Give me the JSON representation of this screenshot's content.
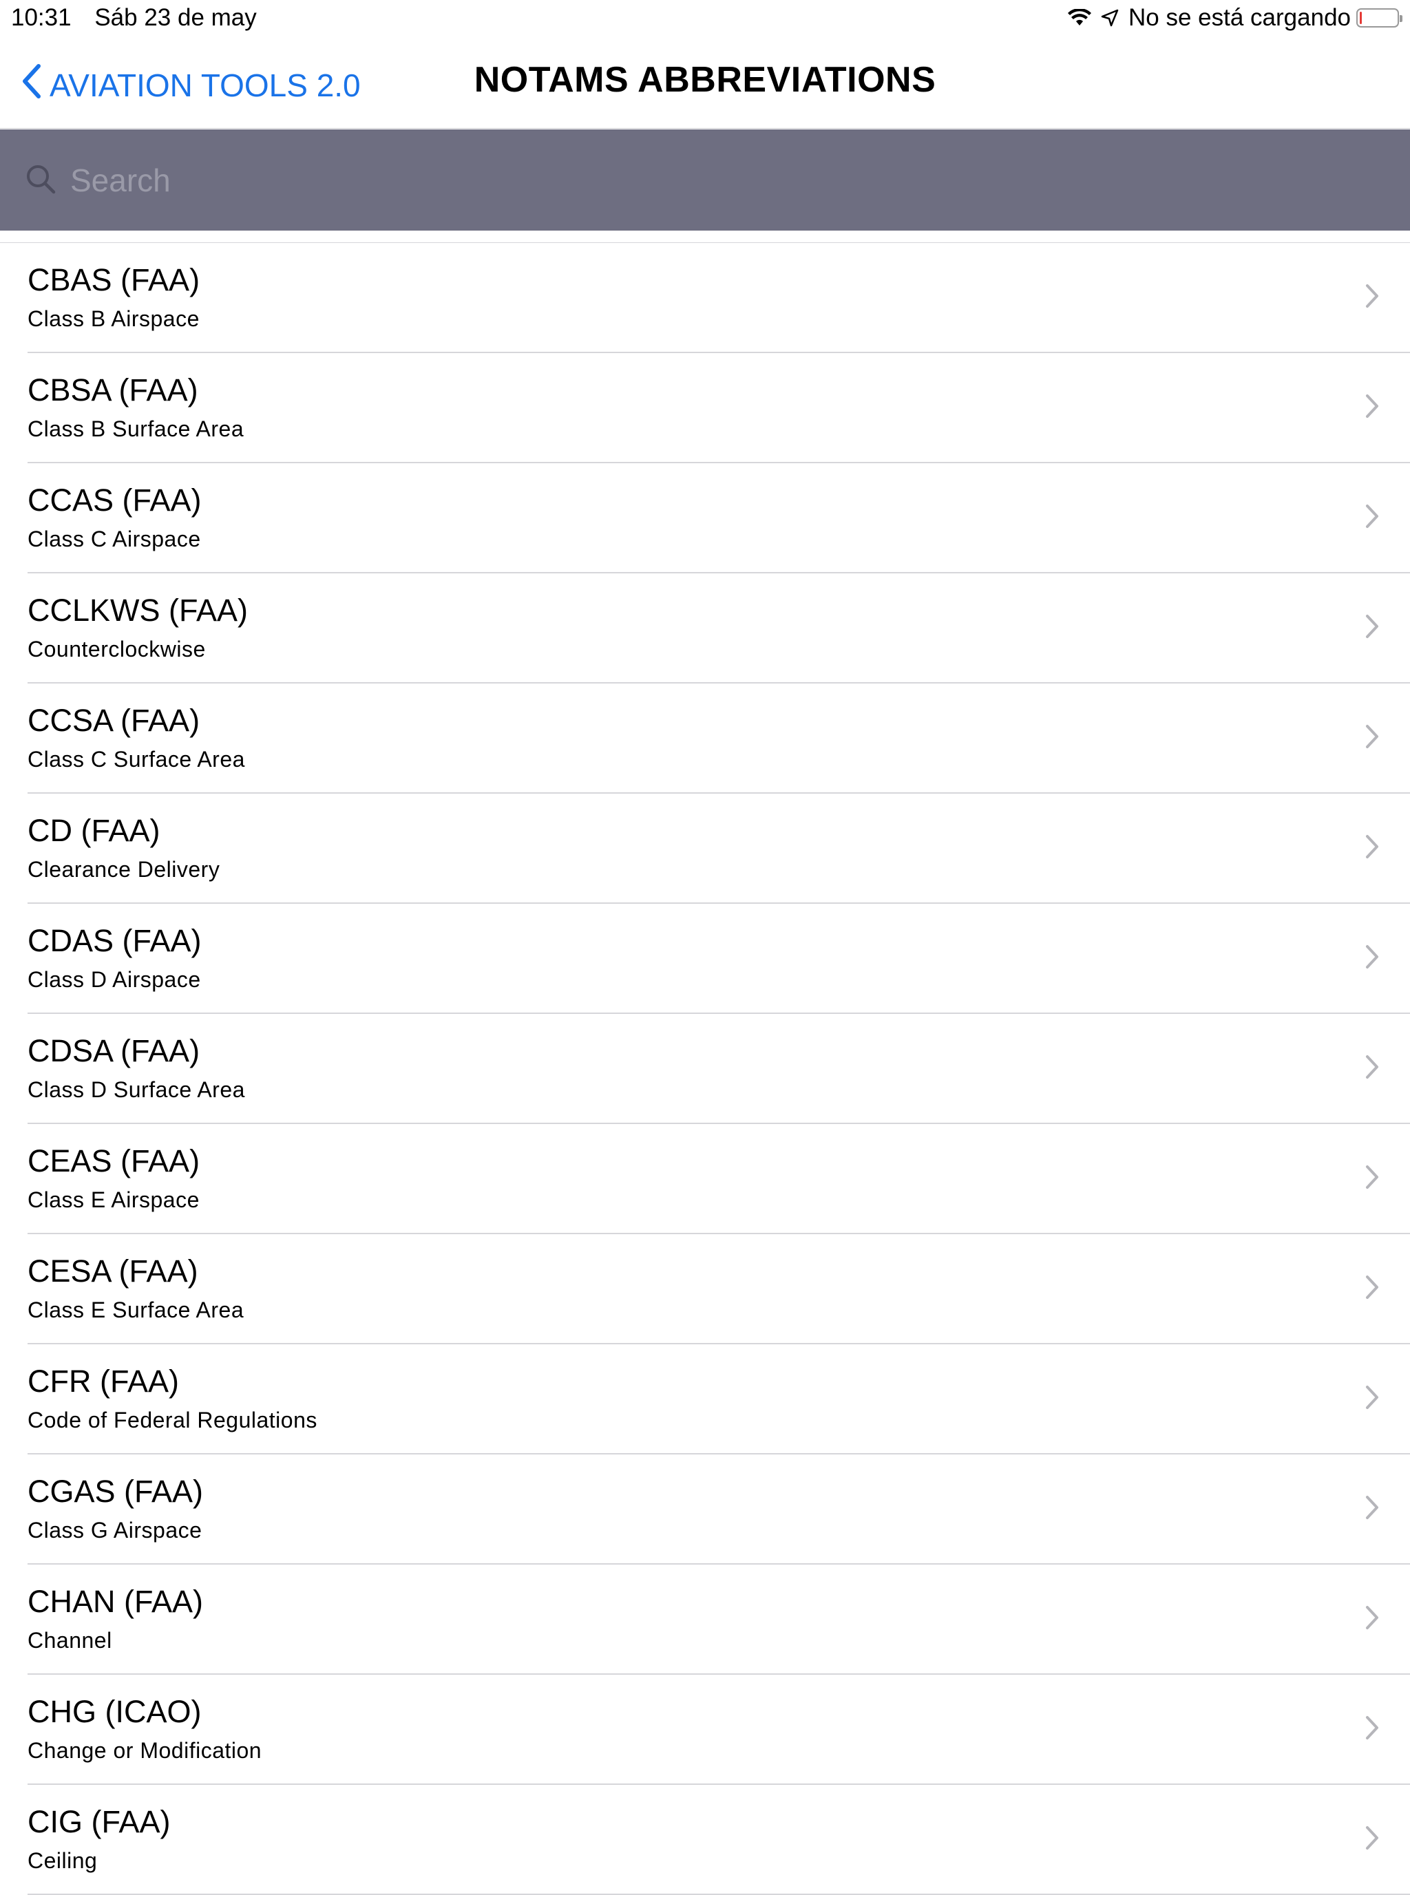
{
  "status_bar": {
    "time": "10:31",
    "date": "Sáb 23 de may",
    "charging_text": "No se está cargando",
    "battery_level": 0.05,
    "battery_color": "#e53935"
  },
  "nav": {
    "back_label": "AVIATION TOOLS 2.0",
    "back_icon": "chevron-left-icon",
    "title": "NOTAMS ABBREVIATIONS",
    "accent_color": "#1a73e8"
  },
  "search": {
    "placeholder": "Search",
    "value": "",
    "bar_color": "#6e6e81"
  },
  "items": [
    {
      "title": "CBAS (FAA)",
      "subtitle": "Class B Airspace"
    },
    {
      "title": "CBSA (FAA)",
      "subtitle": "Class B Surface Area"
    },
    {
      "title": "CCAS (FAA)",
      "subtitle": "Class C Airspace"
    },
    {
      "title": "CCLKWS (FAA)",
      "subtitle": "Counterclockwise"
    },
    {
      "title": "CCSA (FAA)",
      "subtitle": "Class C Surface Area"
    },
    {
      "title": "CD (FAA)",
      "subtitle": "Clearance Delivery"
    },
    {
      "title": "CDAS (FAA)",
      "subtitle": "Class D Airspace"
    },
    {
      "title": "CDSA (FAA)",
      "subtitle": "Class D Surface Area"
    },
    {
      "title": "CEAS (FAA)",
      "subtitle": "Class E Airspace"
    },
    {
      "title": "CESA (FAA)",
      "subtitle": "Class E Surface Area"
    },
    {
      "title": "CFR (FAA)",
      "subtitle": "Code of Federal Regulations"
    },
    {
      "title": "CGAS (FAA)",
      "subtitle": "Class G Airspace"
    },
    {
      "title": "CHAN (FAA)",
      "subtitle": "Channel"
    },
    {
      "title": "CHG (ICAO)",
      "subtitle": "Change or Modification"
    },
    {
      "title": "CIG (FAA)",
      "subtitle": "Ceiling"
    }
  ]
}
